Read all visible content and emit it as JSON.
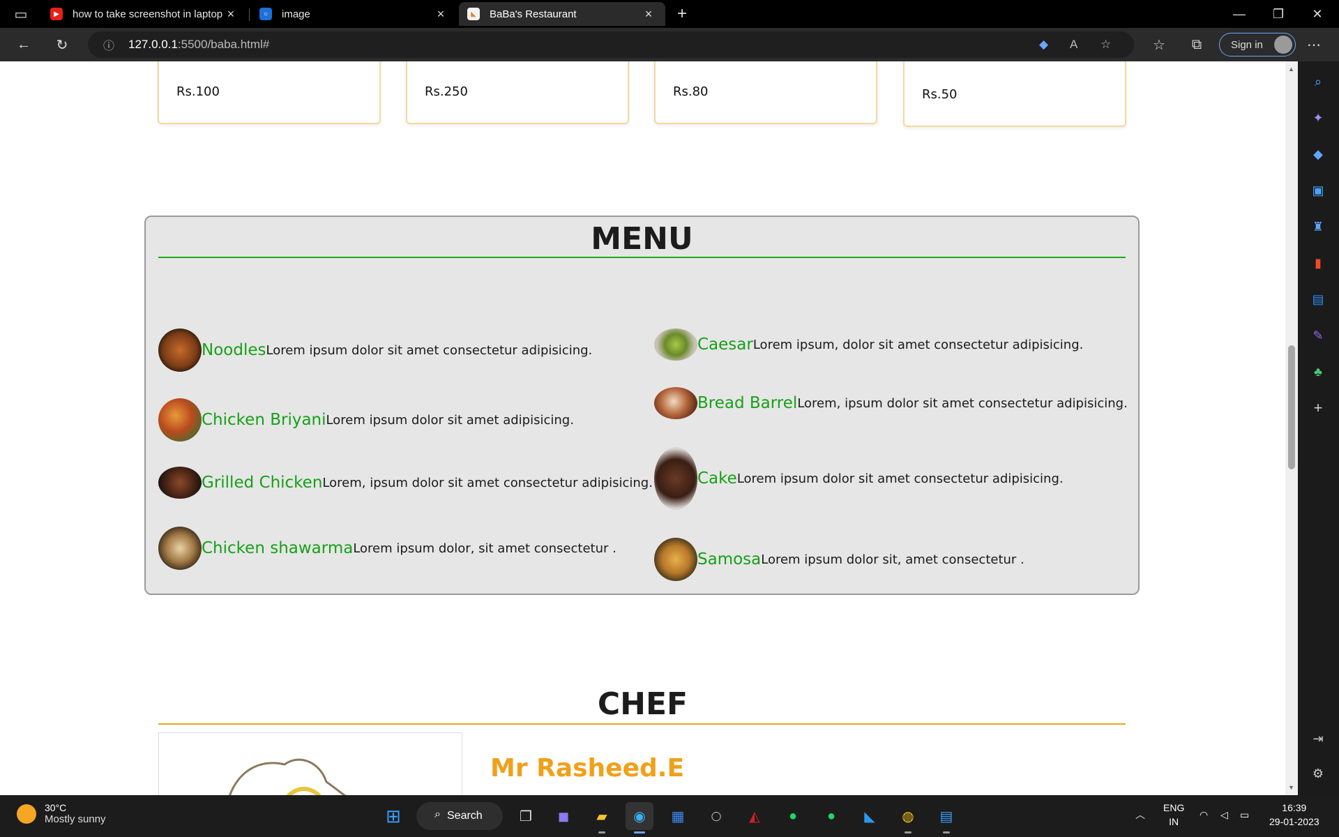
{
  "browser": {
    "tabs": [
      {
        "title": "how to take screenshot in laptop",
        "icon": "youtube-icon",
        "active": false
      },
      {
        "title": "image",
        "icon": "site-icon",
        "active": false
      },
      {
        "title": "BaBa's Restaurant",
        "icon": "page-icon",
        "active": true
      }
    ],
    "new_tab": "+",
    "url_host": "127.0.0.1",
    "url_rest": ":5500/baba.html#",
    "signin_label": "Sign in"
  },
  "page": {
    "prices": [
      "Rs.100",
      "Rs.250",
      "Rs.80",
      "Rs.50"
    ],
    "stars": "★★★★★",
    "menu": {
      "title": "MENU",
      "left": [
        {
          "name": "Noodles",
          "desc": "Lorem ipsum dolor sit amet consectetur adipisicing."
        },
        {
          "name": "Chicken Briyani",
          "desc": "Lorem ipsum dolor sit amet adipisicing."
        },
        {
          "name": "Grilled Chicken",
          "desc": " Lorem, ipsum dolor sit amet consectetur adipisicing."
        },
        {
          "name": "Chicken shawarma",
          "desc": "Lorem ipsum dolor, sit amet consectetur ."
        }
      ],
      "right": [
        {
          "name": "Caesar",
          "desc": "Lorem ipsum, dolor sit amet consectetur adipisicing."
        },
        {
          "name": "Bread Barrel",
          "desc": "Lorem, ipsum dolor sit amet consectetur adipisicing."
        },
        {
          "name": "Cake",
          "desc": "Lorem ipsum dolor sit amet consectetur adipisicing."
        },
        {
          "name": "Samosa",
          "desc": "Lorem ipsum dolor sit, amet consectetur ."
        }
      ]
    },
    "chef": {
      "title": "CHEF",
      "name": "Mr Rasheed.E"
    }
  },
  "taskbar": {
    "weather_temp": "30°C",
    "weather_text": "Mostly sunny",
    "search_label": "Search",
    "lang_1": "ENG",
    "lang_2": "IN",
    "time": "16:39",
    "date": "29-01-2023"
  },
  "colors": {
    "menu_name": "#17a017",
    "chef_accent": "#f0a01a",
    "card_border": "#f5d79e"
  }
}
